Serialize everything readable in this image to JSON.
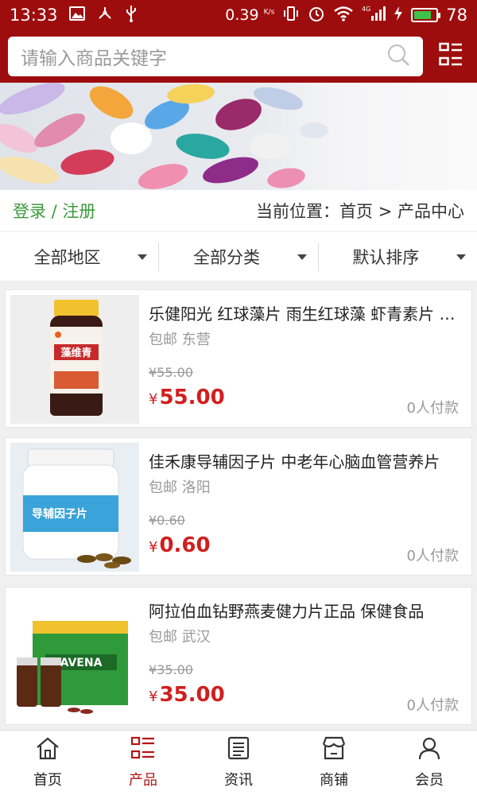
{
  "status_bar": {
    "time": "13:33",
    "net_speed": "0.39",
    "net_unit": "K/s",
    "network": "4G",
    "battery": "78"
  },
  "header": {
    "search_placeholder": "请输入商品关键字",
    "search_icon": "search-icon",
    "menu_icon": "grid-list-icon"
  },
  "breadcrumb": {
    "login_text": "登录 / 注册",
    "location_text": "当前位置：首页 > 产品中心"
  },
  "filters": [
    {
      "label": "全部地区"
    },
    {
      "label": "全部分类"
    },
    {
      "label": "默认排序"
    }
  ],
  "products": [
    {
      "title": "乐健阳光 红球藻片 雨生红球藻 虾青素片 软胶囊",
      "shipping": "包邮",
      "city": "东营",
      "orig_price": "¥55.00",
      "currency": "¥",
      "price": "55.00",
      "buyers": "0人付款",
      "bottle_text": "藻维青"
    },
    {
      "title": "佳禾康导辅因子片 中老年心脑血管营养片",
      "shipping": "包邮",
      "city": "洛阳",
      "orig_price": "¥0.60",
      "currency": "¥",
      "price": "0.60",
      "buyers": "0人付款",
      "bottle_text": "导辅因子片"
    },
    {
      "title": "阿拉伯血钻野燕麦健力片正品 保健食品",
      "shipping": "包邮",
      "city": "武汉",
      "orig_price": "¥35.00",
      "currency": "¥",
      "price": "35.00",
      "buyers": "0人付款",
      "bottle_text": "AVENA"
    }
  ],
  "tabs": [
    {
      "label": "首页",
      "icon": "home-icon",
      "active": false
    },
    {
      "label": "产品",
      "icon": "product-list-icon",
      "active": true
    },
    {
      "label": "资讯",
      "icon": "news-icon",
      "active": false
    },
    {
      "label": "商铺",
      "icon": "store-icon",
      "active": false
    },
    {
      "label": "会员",
      "icon": "user-icon",
      "active": false
    }
  ],
  "colors": {
    "brand": "#9e0d0d",
    "price": "#d21e1e",
    "login": "#3b9a3b",
    "active_tab": "#b31414"
  }
}
